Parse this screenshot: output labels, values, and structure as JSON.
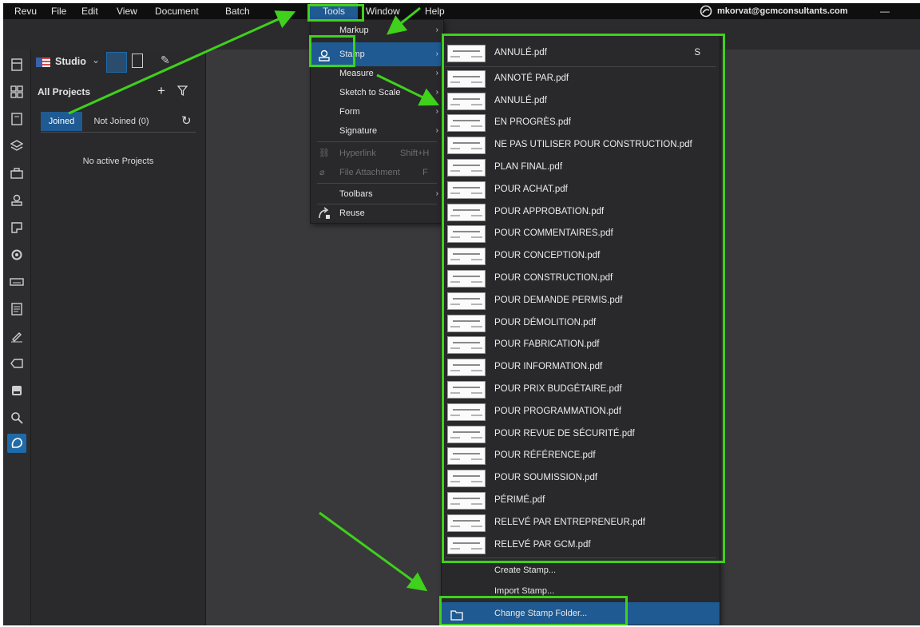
{
  "menubar": {
    "items": [
      "Revu",
      "File",
      "Edit",
      "View",
      "Document",
      "Batch",
      "Tools",
      "Window",
      "Help"
    ],
    "account": "mkorvat@gcmconsultants.com",
    "minimize": "—"
  },
  "studio": {
    "title": "Studio",
    "dropdown_caret": "⌄",
    "section_title": "All Projects",
    "add": "+",
    "tabs": [
      "Joined",
      "Not Joined (0)"
    ],
    "empty_text": "No active Projects"
  },
  "tools_menu": {
    "items": [
      {
        "label": "Markup",
        "submenu": true,
        "icon": ""
      },
      {
        "label": "Stamp",
        "submenu": true,
        "icon": "stamp-icon",
        "selected": true
      },
      {
        "label": "Measure",
        "submenu": true,
        "icon": ""
      },
      {
        "label": "Sketch to Scale",
        "submenu": true,
        "icon": ""
      },
      {
        "label": "Form",
        "submenu": true,
        "icon": ""
      },
      {
        "label": "Signature",
        "submenu": true,
        "icon": ""
      },
      {
        "label": "Hyperlink",
        "shortcut": "Shift+H",
        "disabled": true,
        "icon": "link-icon"
      },
      {
        "label": "File Attachment",
        "shortcut": "F",
        "disabled": true,
        "icon": "paperclip-icon"
      },
      {
        "label": "Toolbars",
        "submenu": true,
        "icon": ""
      },
      {
        "label": "Reuse",
        "submenu": false,
        "icon": "reuse-icon"
      }
    ]
  },
  "stamp_menu": {
    "stamps": [
      {
        "label": "ANNULÉ.pdf",
        "shortcut": "S"
      },
      {
        "label": "ANNOTÉ PAR.pdf"
      },
      {
        "label": "ANNULÉ.pdf"
      },
      {
        "label": "EN PROGRÈS.pdf"
      },
      {
        "label": "NE PAS UTILISER POUR CONSTRUCTION.pdf"
      },
      {
        "label": "PLAN FINAL.pdf"
      },
      {
        "label": "POUR ACHAT.pdf"
      },
      {
        "label": "POUR APPROBATION.pdf"
      },
      {
        "label": "POUR COMMENTAIRES.pdf"
      },
      {
        "label": "POUR CONCEPTION.pdf"
      },
      {
        "label": "POUR CONSTRUCTION.pdf"
      },
      {
        "label": "POUR DEMANDE PERMIS.pdf"
      },
      {
        "label": "POUR DÉMOLITION.pdf"
      },
      {
        "label": "POUR FABRICATION.pdf"
      },
      {
        "label": "POUR INFORMATION.pdf"
      },
      {
        "label": "POUR PRIX BUDGÉTAIRE.pdf"
      },
      {
        "label": "POUR PROGRAMMATION.pdf"
      },
      {
        "label": "POUR REVUE DE SÉCURITÉ.pdf"
      },
      {
        "label": "POUR RÉFÉRENCE.pdf"
      },
      {
        "label": "POUR SOUMISSION.pdf"
      },
      {
        "label": "PÉRIMÉ.pdf"
      },
      {
        "label": "RELEVÉ PAR ENTREPRENEUR.pdf"
      },
      {
        "label": "RELEVÉ PAR GCM.pdf"
      }
    ],
    "actions": [
      "Create Stamp...",
      "Import Stamp...",
      "Change Stamp Folder..."
    ]
  },
  "colors": {
    "highlight": "#3fd11b",
    "selection": "#1f5a92",
    "accent": "#1f6aa8"
  }
}
